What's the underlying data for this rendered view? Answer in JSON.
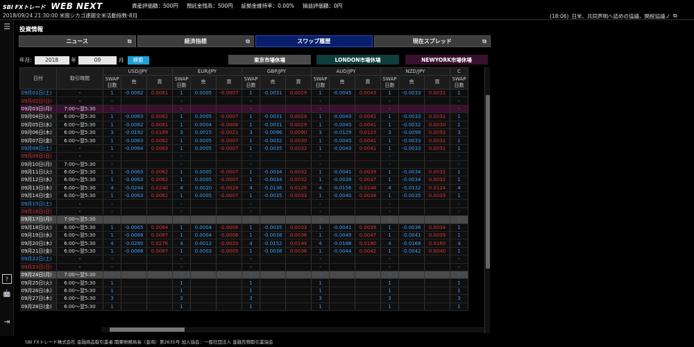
{
  "topbar": {
    "logo_sbi": "SBI FXトレード",
    "logo_webnext": "WEB NEXT",
    "account": [
      "資産評価額：500円",
      "預託金残高：500円",
      "証拠金維持率：0.00%",
      "損益評価額：0円"
    ]
  },
  "ticker": {
    "left": "2018/09/24 21:30:00 米国シカゴ連銀全米活動指数-8月",
    "right_time": "(18:06)",
    "right_text": "日米、共同声明へ詰めの協議、関税協議ノ",
    "right_icon": "external-link-icon"
  },
  "sidebar": {
    "menu_icon": "menu-icon",
    "help_icon": "help-icon",
    "bot_icon": "robot-icon",
    "logout_icon": "logout-icon"
  },
  "page": {
    "title": "投資情報",
    "tabs": [
      {
        "label": "ニュース",
        "active": false
      },
      {
        "label": "経済指標",
        "active": false
      },
      {
        "label": "スワップ履歴",
        "active": true
      },
      {
        "label": "現在スプレッド",
        "active": false
      }
    ],
    "filter": {
      "year_label": "年月:",
      "year": "2018",
      "year_unit": "年",
      "month": "09",
      "month_unit": "月",
      "search": "検索"
    },
    "markets": [
      {
        "label": "東京市場休場",
        "color": "#4a4a4a"
      },
      {
        "label": "LONDON市場休場",
        "color": "#103d3d"
      },
      {
        "label": "NEWYORK市場休場",
        "color": "#3a1030"
      }
    ]
  },
  "table": {
    "headers": {
      "date": "日付",
      "time": "取引時間",
      "days": "SWAP\n日数",
      "sell": "売",
      "buy": "買"
    },
    "pairs": [
      "USD/JPY",
      "EUR/JPY",
      "GBP/JPY",
      "AUD/JPY",
      "NZD/JPY",
      "C"
    ],
    "rows": [
      {
        "date": "09月01日(土)",
        "type": "sat",
        "time": "-",
        "cells": [
          "1",
          "-0.0062",
          "0.0061",
          "1",
          "0.0005",
          "-0.0007",
          "1",
          "-0.0031",
          "0.0029",
          "1",
          "-0.0045",
          "0.0043",
          "1",
          "-0.0033",
          "0.0031",
          "1"
        ]
      },
      {
        "date": "09月02日(日)",
        "type": "sun",
        "time": "-",
        "cells": [
          "-",
          "",
          "",
          "-",
          "",
          "",
          "-",
          "",
          "",
          "-",
          "",
          "",
          "-",
          "",
          "",
          "-"
        ]
      },
      {
        "date": "09月03日(月)",
        "type": "hol",
        "time": "7:00～翌5:30",
        "cells": [
          "-",
          "",
          "",
          "-",
          "",
          "",
          "-",
          "",
          "",
          "-",
          "",
          "",
          "-",
          "",
          "",
          "-"
        ]
      },
      {
        "date": "09月04日(火)",
        "type": "wd",
        "time": "6:00～翌5:30",
        "cells": [
          "1",
          "-0.0063",
          "0.0062",
          "1",
          "0.0005",
          "-0.0007",
          "1",
          "-0.0031",
          "0.0029",
          "1",
          "-0.0043",
          "0.0041",
          "1",
          "-0.0033",
          "0.0031",
          "1"
        ]
      },
      {
        "date": "09月05日(水)",
        "type": "wd",
        "time": "6:00～翌5:30",
        "cells": [
          "1",
          "-0.0062",
          "0.0061",
          "1",
          "0.0004",
          "-0.0006",
          "1",
          "-0.0031",
          "0.0029",
          "1",
          "-0.0043",
          "0.0041",
          "1",
          "-0.0032",
          "0.0030",
          "1"
        ]
      },
      {
        "date": "09月06日(木)",
        "type": "wd",
        "time": "6:00～翌5:30",
        "cells": [
          "3",
          "-0.0192",
          "0.0189",
          "3",
          "0.0015",
          "-0.0021",
          "3",
          "-0.0096",
          "0.0090",
          "3",
          "-0.0129",
          "0.0123",
          "3",
          "-0.0099",
          "0.0093",
          "3"
        ]
      },
      {
        "date": "09月07日(金)",
        "type": "wd",
        "time": "6:00～翌5:30",
        "cells": [
          "1",
          "-0.0063",
          "0.0062",
          "1",
          "0.0005",
          "-0.0007",
          "1",
          "-0.0032",
          "0.0030",
          "1",
          "-0.0043",
          "0.0041",
          "1",
          "-0.0033",
          "0.0031",
          "1"
        ]
      },
      {
        "date": "09月08日(土)",
        "type": "sat",
        "time": "-",
        "cells": [
          "1",
          "-0.0064",
          "0.0063",
          "1",
          "0.0005",
          "-0.0007",
          "1",
          "-0.0035",
          "0.0033",
          "1",
          "-0.0043",
          "0.0041",
          "1",
          "-0.0033",
          "0.0031",
          "1"
        ]
      },
      {
        "date": "09月09日(日)",
        "type": "sun",
        "time": "-",
        "cells": [
          "-",
          "",
          "",
          "-",
          "",
          "",
          "-",
          "",
          "",
          "-",
          "",
          "",
          "-",
          "",
          "",
          "-"
        ]
      },
      {
        "date": "09月10日(月)",
        "type": "wd",
        "time": "7:00～翌5:30",
        "cells": [
          "-",
          "",
          "",
          "-",
          "",
          "",
          "-",
          "",
          "",
          "-",
          "",
          "",
          "-",
          "",
          "",
          "-"
        ]
      },
      {
        "date": "09月11日(火)",
        "type": "wd",
        "time": "6:00～翌5:30",
        "cells": [
          "1",
          "-0.0063",
          "0.0062",
          "1",
          "0.0005",
          "-0.0007",
          "1",
          "-0.0034",
          "0.0032",
          "1",
          "-0.0041",
          "0.0039",
          "1",
          "-0.0034",
          "0.0032",
          "1"
        ]
      },
      {
        "date": "09月12日(水)",
        "type": "wd",
        "time": "6:00～翌5:30",
        "cells": [
          "1",
          "-0.0063",
          "0.0062",
          "1",
          "0.0005",
          "-0.0007",
          "1",
          "-0.0034",
          "0.0032",
          "1",
          "-0.0039",
          "0.0037",
          "1",
          "-0.0034",
          "0.0032",
          "1"
        ]
      },
      {
        "date": "09月13日(木)",
        "type": "wd",
        "time": "6:00～翌5:30",
        "cells": [
          "4",
          "-0.0244",
          "0.0240",
          "4",
          "0.0020",
          "-0.0028",
          "4",
          "-0.0136",
          "0.0128",
          "4",
          "-0.0156",
          "0.0148",
          "4",
          "-0.0132",
          "0.0124",
          "4"
        ]
      },
      {
        "date": "09月14日(金)",
        "type": "wd",
        "time": "6:00～翌5:30",
        "cells": [
          "1",
          "-0.0063",
          "0.0062",
          "1",
          "0.0005",
          "-0.0007",
          "1",
          "-0.0035",
          "0.0033",
          "1",
          "-0.0040",
          "0.0038",
          "1",
          "-0.0035",
          "0.0033",
          "1"
        ]
      },
      {
        "date": "09月15日(土)",
        "type": "sat",
        "time": "-",
        "cells": [
          "-",
          "",
          "",
          "-",
          "",
          "",
          "-",
          "",
          "",
          "-",
          "",
          "",
          "-",
          "",
          "",
          "-"
        ]
      },
      {
        "date": "09月16日(日)",
        "type": "sun",
        "time": "-",
        "cells": [
          "-",
          "",
          "",
          "-",
          "",
          "",
          "-",
          "",
          "",
          "-",
          "",
          "",
          "-",
          "",
          "",
          "-"
        ]
      },
      {
        "date": "09月17日(月)",
        "type": "gray",
        "time": "7:00～翌5:30",
        "cells": [
          "-",
          "",
          "",
          "-",
          "",
          "",
          "-",
          "",
          "",
          "-",
          "",
          "",
          "-",
          "",
          "",
          "-"
        ]
      },
      {
        "date": "09月18日(火)",
        "type": "wd",
        "time": "6:00～翌5:30",
        "cells": [
          "1",
          "-0.0065",
          "0.0064",
          "1",
          "0.0004",
          "-0.0006",
          "1",
          "-0.0035",
          "0.0033",
          "1",
          "-0.0041",
          "0.0039",
          "1",
          "-0.0036",
          "0.0034",
          "1"
        ]
      },
      {
        "date": "09月19日(水)",
        "type": "wd",
        "time": "6:00～翌5:30",
        "cells": [
          "1",
          "-0.0068",
          "0.0067",
          "1",
          "0.0004",
          "-0.0006",
          "1",
          "-0.0038",
          "0.0036",
          "1",
          "-0.0049",
          "0.0047",
          "1",
          "-0.0041",
          "0.0039",
          "1"
        ]
      },
      {
        "date": "09月20日(木)",
        "type": "wd",
        "time": "6:00～翌5:30",
        "cells": [
          "4",
          "-0.0280",
          "0.0276",
          "4",
          "0.0012",
          "-0.0020",
          "4",
          "-0.0152",
          "0.0144",
          "4",
          "-0.0188",
          "0.0180",
          "4",
          "-0.0168",
          "0.0160",
          "4"
        ]
      },
      {
        "date": "09月21日(金)",
        "type": "wd",
        "time": "6:00～翌5:30",
        "cells": [
          "1",
          "-0.0068",
          "0.0067",
          "1",
          "0.0003",
          "-0.0005",
          "1",
          "-0.0038",
          "0.0036",
          "1",
          "-0.0044",
          "0.0042",
          "1",
          "-0.0042",
          "0.0040",
          "1"
        ]
      },
      {
        "date": "09月22日(土)",
        "type": "sat",
        "time": "-",
        "cells": [
          "-",
          "",
          "",
          "-",
          "",
          "",
          "-",
          "",
          "",
          "-",
          "",
          "",
          "-",
          "",
          "",
          "-"
        ]
      },
      {
        "date": "09月23日(日)",
        "type": "sun",
        "time": "-",
        "cells": [
          "-",
          "",
          "",
          "-",
          "",
          "",
          "-",
          "",
          "",
          "-",
          "",
          "",
          "-",
          "",
          "",
          "-"
        ]
      },
      {
        "date": "09月24日(月)",
        "type": "gray",
        "time": "7:00～翌5:30",
        "cells": [
          "-",
          "",
          "",
          "-",
          "",
          "",
          "-",
          "",
          "",
          "-",
          "",
          "",
          "-",
          "",
          "",
          "-"
        ]
      },
      {
        "date": "09月25日(火)",
        "type": "wd",
        "time": "6:00～翌5:30",
        "cells": [
          "1",
          "",
          "",
          "1",
          "",
          "",
          "1",
          "",
          "",
          "1",
          "",
          "",
          "1",
          "",
          "",
          "1"
        ]
      },
      {
        "date": "09月26日(水)",
        "type": "wd",
        "time": "6:00～翌5:30",
        "cells": [
          "1",
          "",
          "",
          "1",
          "",
          "",
          "1",
          "",
          "",
          "1",
          "",
          "",
          "1",
          "",
          "",
          "1"
        ]
      },
      {
        "date": "09月27日(木)",
        "type": "wd",
        "time": "6:00～翌5:30",
        "cells": [
          "3",
          "",
          "",
          "3",
          "",
          "",
          "3",
          "",
          "",
          "3",
          "",
          "",
          "3",
          "",
          "",
          "3"
        ]
      },
      {
        "date": "09月28日(金)",
        "type": "wd",
        "time": "6:00～翌5:30",
        "cells": [
          "1",
          "",
          "",
          "1",
          "",
          "",
          "1",
          "",
          "",
          "1",
          "",
          "",
          "1",
          "",
          "",
          "1"
        ]
      }
    ]
  },
  "footer": "SBI FXトレード株式会社 金融商品取引業者 関東財務局長（金商）第2635号 加入協会：一般社団法人 金融先物取引業協会"
}
